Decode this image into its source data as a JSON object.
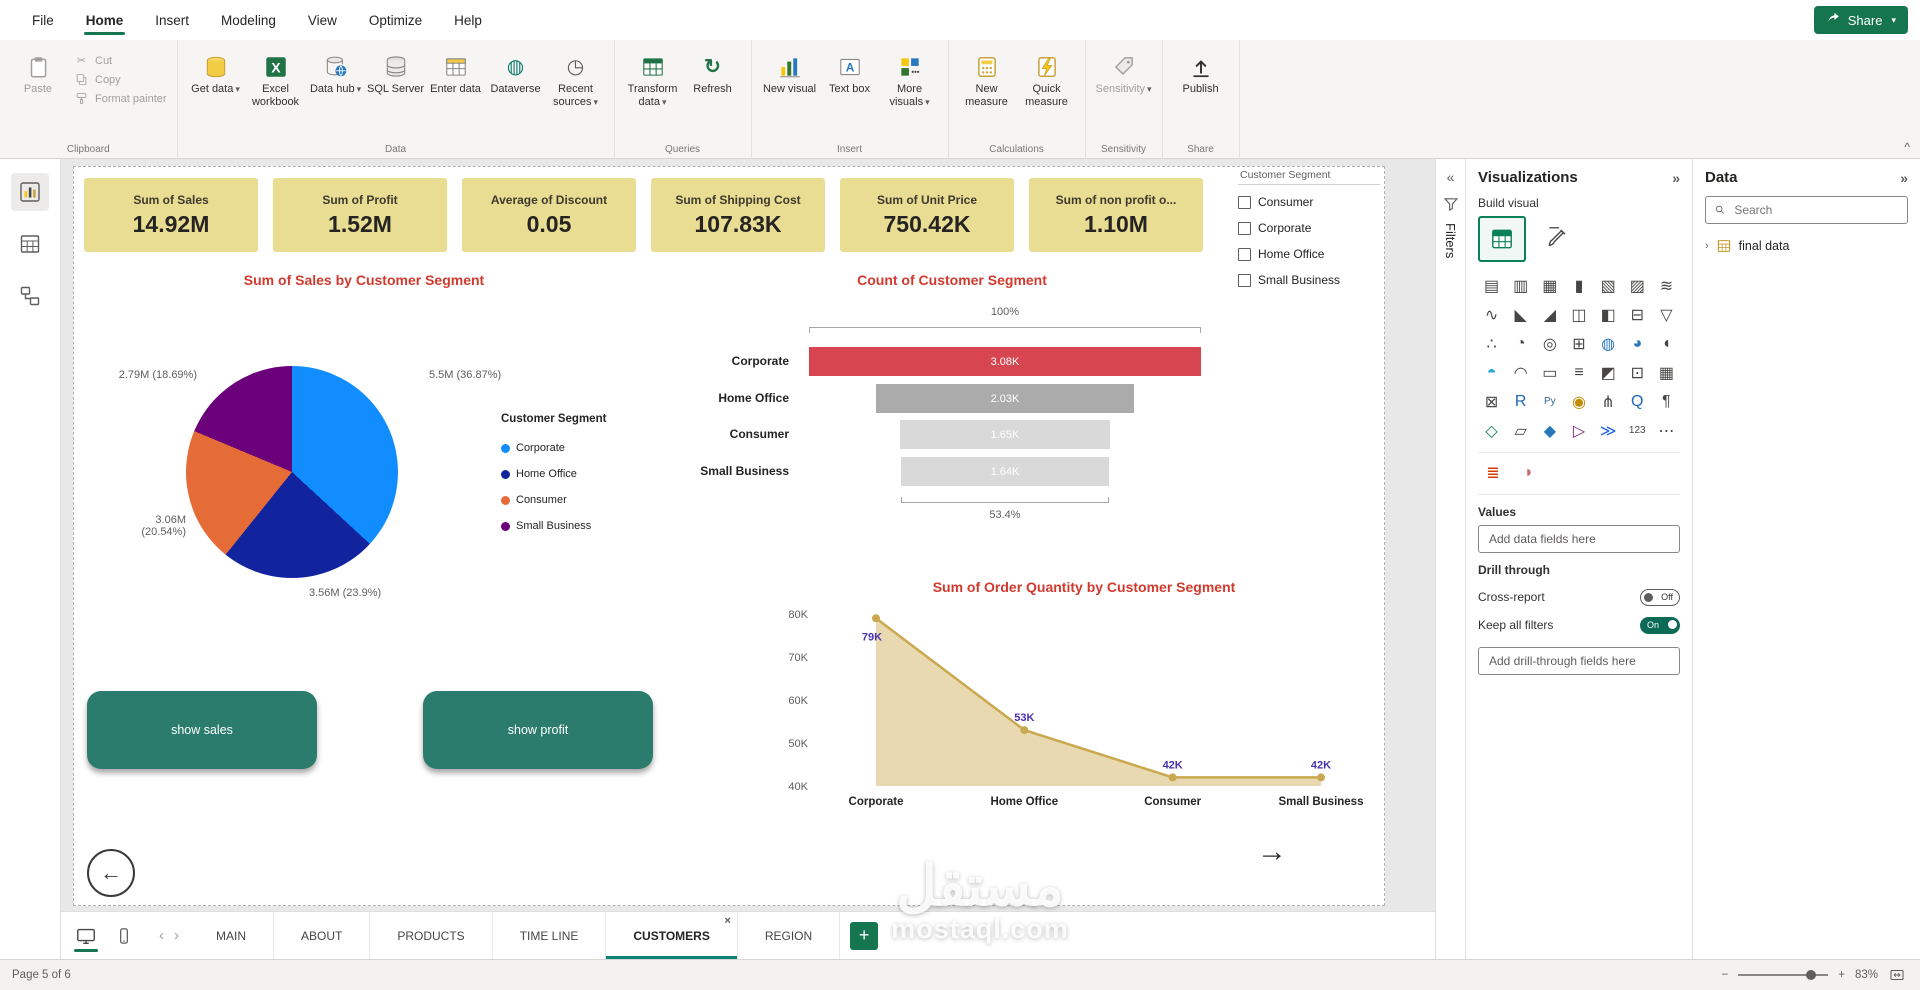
{
  "icons": {
    "chevron_down": "▾",
    "collapse": "^",
    "double_chevron_left": "«",
    "double_chevron_right": "»",
    "chevron_left": "‹",
    "chevron_right": "›",
    "close": "×",
    "back_arrow": "←",
    "forward_arrow": "→",
    "scissors": "✂",
    "refresh": "↻",
    "dataverse": "◍",
    "recent": "◷",
    "minus": "−",
    "plus": "+",
    "add_page": "+"
  },
  "menu": {
    "items": [
      {
        "label": "File"
      },
      {
        "label": "Home"
      },
      {
        "label": "Insert"
      },
      {
        "label": "Modeling"
      },
      {
        "label": "View"
      },
      {
        "label": "Optimize"
      },
      {
        "label": "Help"
      }
    ],
    "share": "Share"
  },
  "ribbon": {
    "clipboard": {
      "label": "Clipboard",
      "paste": "Paste",
      "cut": "Cut",
      "copy": "Copy",
      "format_painter": "Format painter"
    },
    "data": {
      "label": "Data",
      "get_data": "Get data",
      "excel": "Excel workbook",
      "data_hub": "Data hub",
      "sql": "SQL Server",
      "enter_data": "Enter data",
      "dataverse": "Dataverse",
      "recent": "Recent sources"
    },
    "queries": {
      "label": "Queries",
      "transform": "Transform data",
      "refresh": "Refresh"
    },
    "insert_group": {
      "label": "Insert",
      "new_visual": "New visual",
      "text_box": "Text box",
      "more_visuals": "More visuals"
    },
    "calculations": {
      "label": "Calculations",
      "new_measure": "New measure",
      "quick_measure": "Quick measure"
    },
    "sensitivity": {
      "label": "Sensitivity",
      "button": "Sensitivity"
    },
    "share_group": {
      "label": "Share",
      "publish": "Publish"
    }
  },
  "cards": [
    {
      "title": "Sum of Sales",
      "value": "14.92M"
    },
    {
      "title": "Sum of Profit",
      "value": "1.52M"
    },
    {
      "title": "Average of Discount",
      "value": "0.05"
    },
    {
      "title": "Sum of Shipping Cost",
      "value": "107.83K"
    },
    {
      "title": "Sum of Unit Price",
      "value": "750.42K"
    },
    {
      "title": "Sum of non profit o...",
      "value": "1.10M"
    }
  ],
  "slicer": {
    "title": "Customer Segment",
    "items": [
      {
        "label": "Consumer"
      },
      {
        "label": "Corporate"
      },
      {
        "label": "Home Office"
      },
      {
        "label": "Small Business"
      }
    ]
  },
  "pie": {
    "title": "Sum of Sales by Customer Segment",
    "legend_title": "Customer Segment",
    "slices": [
      {
        "name": "Corporate",
        "color": "#118DFF",
        "value": "5.5M",
        "pct": 36.87,
        "label": "5.5M (36.87%)"
      },
      {
        "name": "Home Office",
        "color": "#12239E",
        "value": "3.56M",
        "pct": 23.9,
        "label": "3.56M (23.9%)"
      },
      {
        "name": "Consumer",
        "color": "#E66C37",
        "value": "3.06M",
        "pct": 20.54,
        "label": "3.06M (20.54%)"
      },
      {
        "name": "Small Business",
        "color": "#6B007B",
        "value": "2.79M",
        "pct": 18.69,
        "label": "2.79M (18.69%)"
      }
    ]
  },
  "funnel": {
    "title": "Count of Customer Segment",
    "top_label": "100%",
    "bottom_label": "53.4%",
    "rows": [
      {
        "category": "Corporate",
        "value": "3.08K",
        "pct": 100,
        "color": "#D64550"
      },
      {
        "category": "Home Office",
        "value": "2.03K",
        "pct": 65.9,
        "color": "#ABABAB"
      },
      {
        "category": "Consumer",
        "value": "1.65K",
        "pct": 53.6,
        "color": "#D9D9D9"
      },
      {
        "category": "Small Business",
        "value": "1.64K",
        "pct": 53.2,
        "color": "#D9D9D9"
      }
    ]
  },
  "linechart": {
    "title": "Sum of Order Quantity by Customer Segment",
    "y_ticks": [
      "80K",
      "70K",
      "60K",
      "50K",
      "40K"
    ],
    "ylim": [
      40,
      80
    ],
    "points": [
      {
        "category": "Corporate",
        "label": "79K",
        "value": 79
      },
      {
        "category": "Home Office",
        "label": "53K",
        "value": 53
      },
      {
        "category": "Consumer",
        "label": "42K",
        "value": 42
      },
      {
        "category": "Small Business",
        "label": "42K",
        "value": 42
      }
    ],
    "line_color": "#C9A850",
    "area_color": "#E7D5A7",
    "label_color": "#4633B0"
  },
  "buttons": {
    "show_sales": "show sales",
    "show_profit": "show profit"
  },
  "pages": {
    "tabs": [
      {
        "label": "MAIN"
      },
      {
        "label": "ABOUT"
      },
      {
        "label": "PRODUCTS"
      },
      {
        "label": "TIME LINE"
      },
      {
        "label": "CUSTOMERS"
      },
      {
        "label": "REGION"
      }
    ],
    "active": "CUSTOMERS"
  },
  "status": {
    "page": "Page 5 of 6",
    "zoom": "83%"
  },
  "filters_panel": {
    "title": "Filters"
  },
  "viz_panel": {
    "title": "Visualizations",
    "build_visual": "Build visual",
    "values_label": "Values",
    "add_fields": "Add data fields here",
    "drill_label": "Drill through",
    "cross_report": "Cross-report",
    "off": "Off",
    "keep_filters": "Keep all filters",
    "on": "On",
    "add_drill": "Add drill-through fields here",
    "visual_icons": [
      {
        "name": "stacked-bar-chart",
        "glyph": "▤"
      },
      {
        "name": "stacked-column-chart",
        "glyph": "▥"
      },
      {
        "name": "clustered-bar-chart",
        "glyph": "▦"
      },
      {
        "name": "clustered-column-chart",
        "glyph": "▮"
      },
      {
        "name": "hundred-stacked-bar-chart",
        "glyph": "▧"
      },
      {
        "name": "hundred-stacked-column-chart",
        "glyph": "▨"
      },
      {
        "name": "ribbon-chart",
        "glyph": "≋"
      },
      {
        "name": "line-chart",
        "glyph": "∿"
      },
      {
        "name": "area-chart",
        "glyph": "◣"
      },
      {
        "name": "stacked-area-chart",
        "glyph": "◢"
      },
      {
        "name": "line-stacked-column-chart",
        "glyph": "◫"
      },
      {
        "name": "line-clustered-column-chart",
        "glyph": "◧"
      },
      {
        "name": "waterfall-chart",
        "glyph": "⊟"
      },
      {
        "name": "funnel-chart",
        "glyph": "▽"
      },
      {
        "name": "scatter-chart",
        "glyph": "∴"
      },
      {
        "name": "pie-chart",
        "glyph": "◔"
      },
      {
        "name": "donut-chart",
        "glyph": "◎"
      },
      {
        "name": "treemap",
        "glyph": "⊞"
      },
      {
        "name": "map",
        "glyph": "◍",
        "color": "#2878BD"
      },
      {
        "name": "filled-map",
        "glyph": "◕",
        "color": "#2878BD"
      },
      {
        "name": "shape-map",
        "glyph": "◖"
      },
      {
        "name": "azure-map",
        "glyph": "◓",
        "color": "#28A8D8"
      },
      {
        "name": "gauge",
        "glyph": "◠"
      },
      {
        "name": "card",
        "glyph": "▭"
      },
      {
        "name": "multi-row-card",
        "glyph": "≡"
      },
      {
        "name": "kpi",
        "glyph": "◩"
      },
      {
        "name": "slicer",
        "glyph": "⊡"
      },
      {
        "name": "table",
        "glyph": "▦"
      },
      {
        "name": "matrix",
        "glyph": "⊠"
      },
      {
        "name": "r-script-visual",
        "glyph": "R",
        "color": "#2267B8"
      },
      {
        "name": "python-visual",
        "glyph": "Py",
        "color": "#306998"
      },
      {
        "name": "key-influencers",
        "glyph": "◉",
        "color": "#C28E00"
      },
      {
        "name": "decomposition-tree",
        "glyph": "⋔"
      },
      {
        "name": "qa-visual",
        "glyph": "Q",
        "color": "#2267B8"
      },
      {
        "name": "smart-narrative",
        "glyph": "¶"
      },
      {
        "name": "metrics",
        "glyph": "◇",
        "color": "#0B815A"
      },
      {
        "name": "paginated-report",
        "glyph": "▱"
      },
      {
        "name": "arcgis-map",
        "glyph": "◆",
        "color": "#2878BD"
      },
      {
        "name": "power-apps",
        "glyph": "▷",
        "color": "#742774"
      },
      {
        "name": "power-automate",
        "glyph": "≫",
        "color": "#2266E3"
      },
      {
        "name": "numeric-card",
        "glyph": "123"
      },
      {
        "name": "more-visuals-options",
        "glyph": "⋯"
      }
    ],
    "extra_icons": [
      {
        "name": "sort-axis",
        "glyph": "≣",
        "color": "#D83B01"
      },
      {
        "name": "copilot",
        "glyph": "◗",
        "color": "#C96A6A"
      }
    ]
  },
  "data_panel": {
    "title": "Data",
    "search_placeholder": "Search",
    "field": "final data"
  },
  "watermark": {
    "arabic": "مستقل",
    "latin": "mostaql.com"
  },
  "chart_data": [
    {
      "type": "pie",
      "title": "Sum of Sales by Customer Segment",
      "categories": [
        "Corporate",
        "Home Office",
        "Consumer",
        "Small Business"
      ],
      "values": [
        "5.5M",
        "3.56M",
        "3.06M",
        "2.79M"
      ],
      "percentages": [
        36.87,
        23.9,
        20.54,
        18.69
      ],
      "colors": [
        "#118DFF",
        "#12239E",
        "#E66C37",
        "#6B007B"
      ],
      "legend_position": "right"
    },
    {
      "type": "funnel",
      "title": "Count of Customer Segment",
      "categories": [
        "Corporate",
        "Home Office",
        "Consumer",
        "Small Business"
      ],
      "values": [
        3080,
        2030,
        1650,
        1640
      ],
      "labels": [
        "3.08K",
        "2.03K",
        "1.65K",
        "1.64K"
      ],
      "top_annotation": "100%",
      "bottom_annotation": "53.4%"
    },
    {
      "type": "area",
      "title": "Sum of Order Quantity by Customer Segment",
      "categories": [
        "Corporate",
        "Home Office",
        "Consumer",
        "Small Business"
      ],
      "values": [
        79000,
        53000,
        42000,
        42000
      ],
      "labels": [
        "79K",
        "53K",
        "42K",
        "42K"
      ],
      "ylim": [
        40000,
        80000
      ],
      "y_ticks": [
        "80K",
        "70K",
        "60K",
        "50K",
        "40K"
      ]
    }
  ]
}
